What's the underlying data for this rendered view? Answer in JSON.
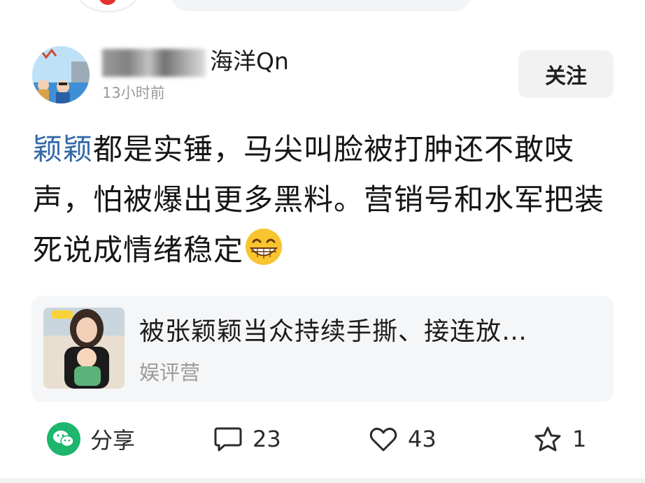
{
  "top": {
    "partial_icons": [
      "red-avatar-icon",
      "search-bar",
      "more-dots-icon"
    ]
  },
  "post": {
    "author": {
      "name_visible": "海洋Qn",
      "avatar": "avatar-image"
    },
    "time": "13小时前",
    "follow_label": "关注",
    "text": {
      "mention": "颖颖",
      "body": "都是实锤，马尖叫脸被打肿还不敢吱声，怕被爆出更多黑料。营销号和水军把装死说成情绪稳定",
      "emoji": "grinning-face-emoji"
    },
    "link_card": {
      "title": "被张颖颖当众持续手撕、接连放…",
      "source": "娱评营",
      "thumbnail": "woman-with-baby-image"
    },
    "actions": {
      "share_label": "分享",
      "comment_count": "23",
      "like_count": "43",
      "favorite_count": "1"
    }
  },
  "colors": {
    "mention": "#3168a8",
    "wechat_green": "#1db66d",
    "muted_text": "#9a9a9a",
    "follow_bg": "#f2f2f3",
    "card_bg": "#f5f6f8"
  }
}
